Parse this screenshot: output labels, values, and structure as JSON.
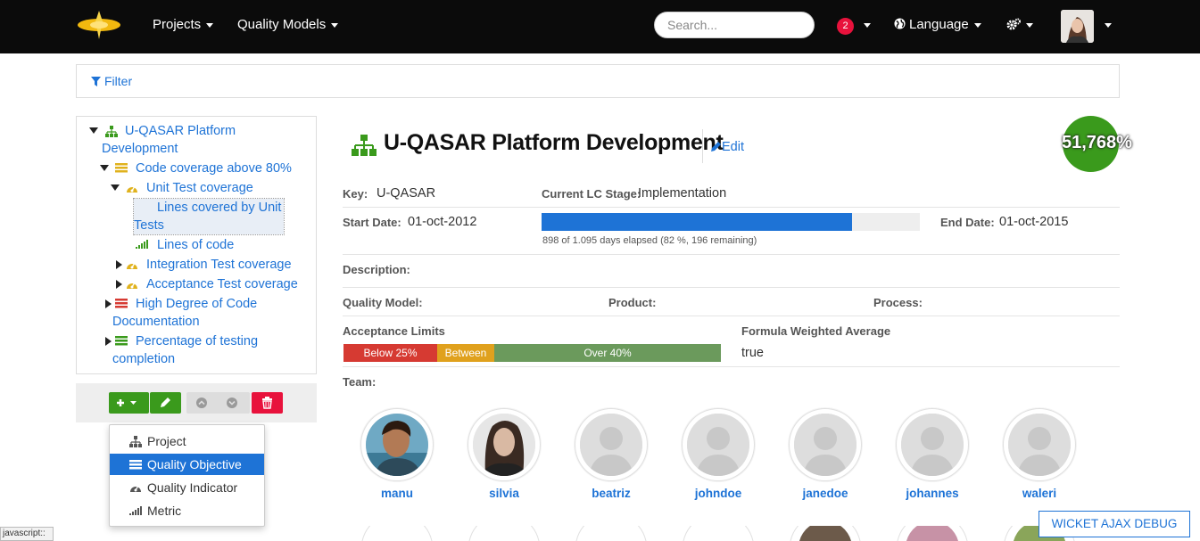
{
  "navbar": {
    "projects_label": "Projects",
    "quality_models_label": "Quality Models",
    "search_placeholder": "Search...",
    "notifications_count": "2",
    "language_label": "Language"
  },
  "filter": {
    "label": "Filter"
  },
  "tree": {
    "root": "U-QASAR Platform Development",
    "n1": "Code coverage above 80%",
    "n2": "Unit Test coverage",
    "n3": "Lines covered by Unit Tests",
    "n4": "Lines of code",
    "n5": "Integration Test coverage",
    "n6": "Acceptance Test coverage",
    "n7": "High Degree of Code Documentation",
    "n8": "Percentage of testing completion"
  },
  "add_menu": {
    "items": [
      "Project",
      "Quality Objective",
      "Quality Indicator",
      "Metric"
    ],
    "active_index": 1
  },
  "project": {
    "title": "U-QASAR Platform Development",
    "edit_label": "Edit",
    "score": "51,768%",
    "key_label": "Key:",
    "key_value": "U-QASAR",
    "lc_label": "Current LC Stage:",
    "lc_value": "Implementation",
    "start_label": "Start Date:",
    "start_value": "01-oct-2012",
    "end_label": "End Date:",
    "end_value": "01-oct-2015",
    "progress_percent": 82,
    "progress_text": "898 of 1.095 days elapsed (82 %, 196 remaining)",
    "description_label": "Description:",
    "quality_model_label": "Quality Model:",
    "product_label": "Product:",
    "process_label": "Process:",
    "acceptance_label": "Acceptance Limits",
    "acc_below": "Below 25%",
    "acc_between": "Between",
    "acc_over": "Over 40%",
    "formula_label": "Formula Weighted Average",
    "formula_value": "true",
    "team_label": "Team:"
  },
  "team": [
    "manu",
    "silvia",
    "beatriz",
    "johndoe",
    "janedoe",
    "johannes",
    "waleri"
  ],
  "colors": {
    "accent": "#1e73d6",
    "score_green": "#3a9a1c",
    "below": "#d63a32",
    "between": "#e0a11d",
    "over": "#6b9a5c"
  },
  "debug": {
    "wicket": "WICKET AJAX DEBUG",
    "js_tip": "javascript::"
  }
}
